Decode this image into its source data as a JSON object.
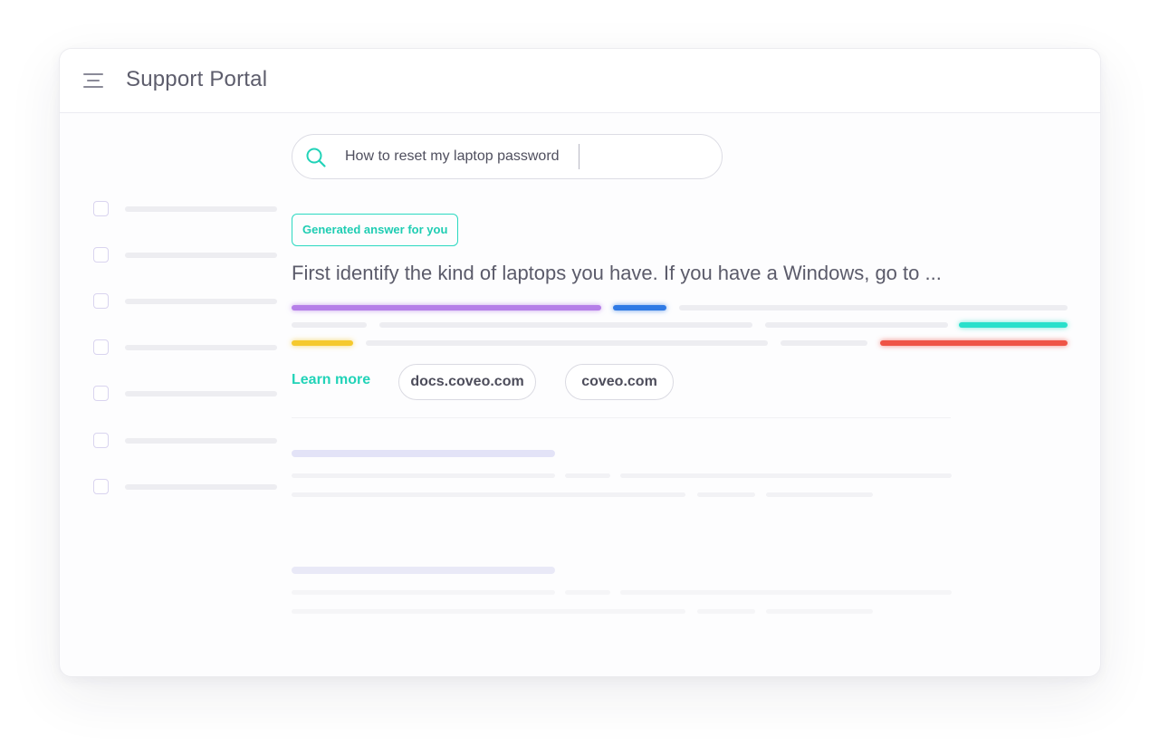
{
  "header": {
    "title": "Support Portal",
    "menu_icon": "hamburger-menu-icon"
  },
  "search": {
    "value": "How to reset my laptop password",
    "icon": "search-icon",
    "icon_color": "#22d3b8"
  },
  "answer": {
    "badge_label": "Generated answer for you",
    "text": "First identify the kind of laptops you have. If you have a Windows, go to ...",
    "highlight_colors": [
      "#b57ee8",
      "#2f7ae5",
      "#29e0cb",
      "#f5c92e",
      "#ef5446"
    ],
    "learn_more_label": "Learn more",
    "sources": [
      "docs.coveo.com",
      "coveo.com"
    ]
  },
  "colors": {
    "accent": "#22d3b8",
    "text": "#5b5b6a",
    "placeholder": "#ededf1",
    "result_title_placeholder": "#e3e3f7"
  }
}
